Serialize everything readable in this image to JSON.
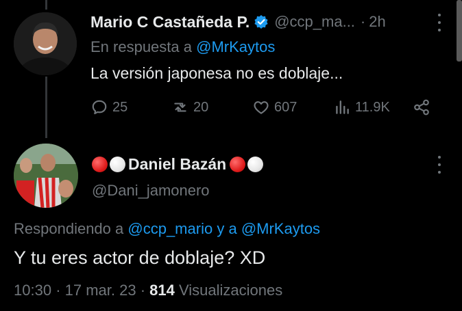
{
  "tweet1": {
    "name": "Mario C Castañeda P.",
    "handle": "@ccp_ma...",
    "separator": "·",
    "time": "2h",
    "reply_prefix": "En respuesta a",
    "reply_handle": "@MrKaytos",
    "text": "La versión japonesa no es doblaje...",
    "stats": {
      "replies": "25",
      "retweets": "20",
      "likes": "607",
      "views": "11.9K"
    }
  },
  "tweet2": {
    "name": "Daniel Bazán",
    "handle": "@Dani_jamonero",
    "replying_prefix": "Respondiendo a",
    "replying_handle_1": "@ccp_mario",
    "replying_join": "y a",
    "replying_handle_2": "@MrKaytos",
    "text": "Y tu eres actor de doblaje? XD",
    "time": "10:30",
    "date": "17 mar. 23",
    "separator_1": "·",
    "separator_2": "·",
    "views_count": "814",
    "views_label": "Visualizaciones"
  },
  "colors": {
    "background": "#000000",
    "text": "#e7e9ea",
    "muted": "#71767b",
    "accent": "#1d9bf0"
  },
  "icons": [
    "verified-badge-icon",
    "more-options-icon",
    "reply-icon",
    "retweet-icon",
    "like-icon",
    "views-icon",
    "share-icon"
  ]
}
